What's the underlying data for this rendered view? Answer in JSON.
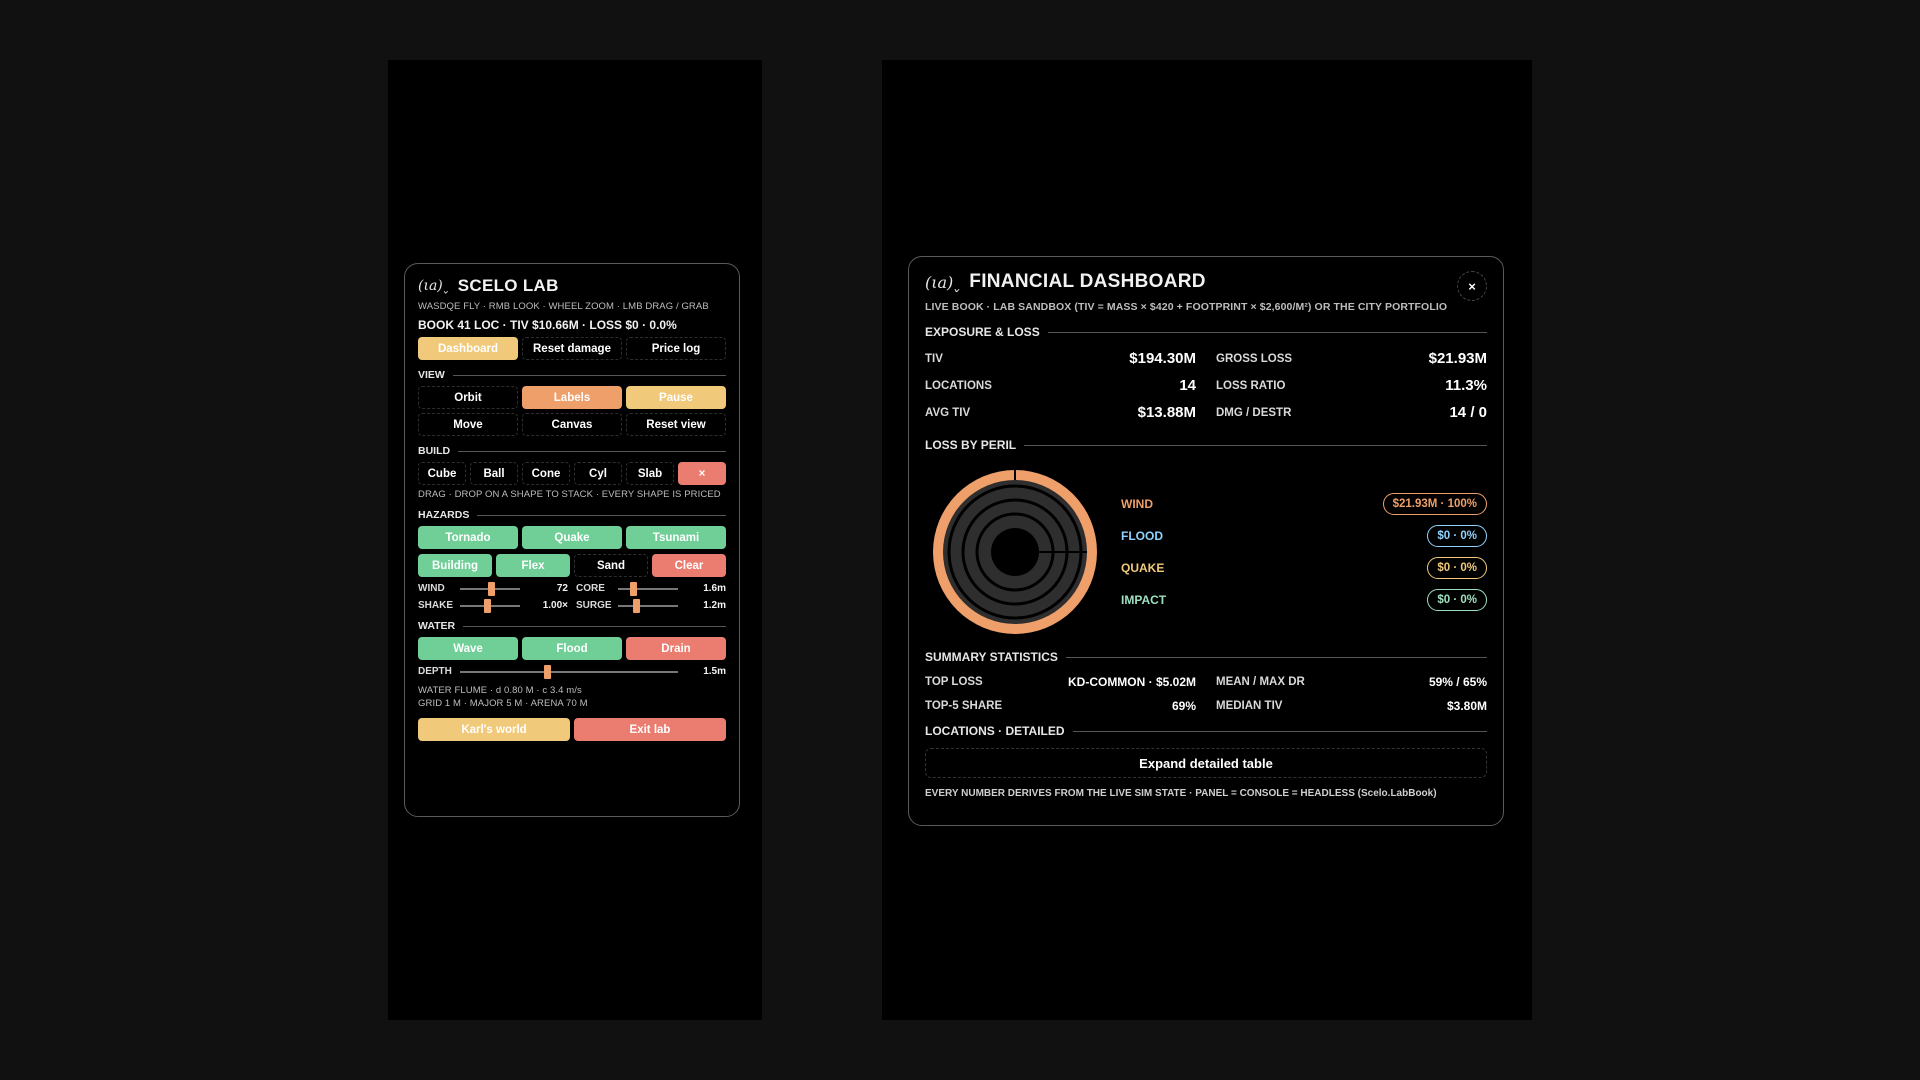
{
  "lab": {
    "logo": "(ιa)˯",
    "title": "SCELO LAB",
    "controls_hint": "WASDQE FLY · RMB LOOK · WHEEL ZOOM · LMB DRAG / GRAB",
    "book_summary": "BOOK 41 LOC · TIV $10.66M · LOSS $0 · 0.0%",
    "top_buttons": [
      "Dashboard",
      "Reset damage",
      "Price log"
    ],
    "view": {
      "heading": "VIEW",
      "buttons": [
        "Orbit",
        "Labels",
        "Pause",
        "Move",
        "Canvas",
        "Reset view"
      ]
    },
    "build": {
      "heading": "BUILD",
      "buttons": [
        "Cube",
        "Ball",
        "Cone",
        "Cyl",
        "Slab",
        "×"
      ],
      "hint": "DRAG · DROP ON A SHAPE TO STACK · EVERY SHAPE IS PRICED"
    },
    "hazards": {
      "heading": "HAZARDS",
      "row1": [
        "Tornado",
        "Quake",
        "Tsunami"
      ],
      "row2": [
        "Building",
        "Flex",
        "Sand",
        "Clear"
      ],
      "sliders": [
        {
          "label": "WIND",
          "value": "72",
          "level": 0.52
        },
        {
          "label": "CORE",
          "value": "1.6m",
          "level": 0.25
        },
        {
          "label": "SHAKE",
          "value": "1.00×",
          "level": 0.45
        },
        {
          "label": "SURGE",
          "value": "1.2m",
          "level": 0.3
        }
      ]
    },
    "water": {
      "heading": "WATER",
      "buttons": [
        "Wave",
        "Flood",
        "Drain"
      ],
      "depth": {
        "label": "DEPTH",
        "value": "1.5m",
        "level": 0.4
      },
      "info1": "WATER FLUME · d 0.80 M · c 3.4 m/s",
      "info2": "GRID 1 M · MAJOR 5 M · ARENA 70 M"
    },
    "bottom_buttons": [
      "Karl's world",
      "Exit lab"
    ]
  },
  "finance": {
    "logo": "(ιa)˯",
    "title": "FINANCIAL DASHBOARD",
    "close": "×",
    "subtitle": "LIVE BOOK · LAB SANDBOX (TIV = MASS × $420 + FOOTPRINT × $2,600/M²) OR THE CITY PORTFOLIO",
    "exposure": {
      "heading": "EXPOSURE & LOSS",
      "rows": [
        {
          "k": "TIV",
          "v": "$194.30M"
        },
        {
          "k": "GROSS LOSS",
          "v": "$21.93M"
        },
        {
          "k": "LOCATIONS",
          "v": "14"
        },
        {
          "k": "LOSS RATIO",
          "v": "11.3%"
        },
        {
          "k": "AVG TIV",
          "v": "$13.88M"
        },
        {
          "k": "DMG / DESTR",
          "v": "14 / 0"
        }
      ]
    },
    "peril": {
      "heading": "LOSS BY PERIL",
      "items": [
        {
          "name": "WIND",
          "pill": "$21.93M · 100%",
          "color": "#ee9f6a",
          "share": 1.0
        },
        {
          "name": "FLOOD",
          "pill": "$0 · 0%",
          "color": "#8fd3ff",
          "share": 0
        },
        {
          "name": "QUAKE",
          "pill": "$0 · 0%",
          "color": "#f0c97a",
          "share": 0
        },
        {
          "name": "IMPACT",
          "pill": "$0 · 0%",
          "color": "#9fe0c0",
          "share": 0
        }
      ]
    },
    "summary": {
      "heading": "SUMMARY STATISTICS",
      "rows": [
        {
          "k": "TOP LOSS",
          "v": "KD-COMMON · $5.02M"
        },
        {
          "k": "MEAN / MAX DR",
          "v": "59% / 65%"
        },
        {
          "k": "TOP-5 SHARE",
          "v": "69%"
        },
        {
          "k": "MEDIAN TIV",
          "v": "$3.80M"
        }
      ]
    },
    "locations": {
      "heading": "LOCATIONS · DETAILED",
      "expand": "Expand detailed table"
    },
    "footnote": "EVERY NUMBER DERIVES FROM THE LIVE SIM STATE · PANEL = CONSOLE = HEADLESS (Scelo.LabBook)"
  }
}
